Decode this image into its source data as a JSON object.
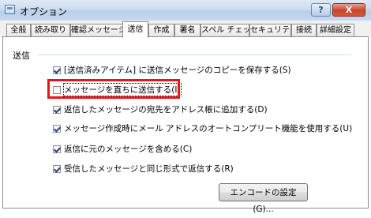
{
  "window": {
    "title": "オプション",
    "help_label": "?",
    "close_label": "X"
  },
  "tabs": [
    {
      "label": "全般",
      "active": false
    },
    {
      "label": "読み取り",
      "active": false
    },
    {
      "label": "確認メッセージ",
      "active": false
    },
    {
      "label": "送信",
      "active": true
    },
    {
      "label": "作成",
      "active": false
    },
    {
      "label": "署名",
      "active": false
    },
    {
      "label": "スペル チェック",
      "active": false
    },
    {
      "label": "セキュリティ",
      "active": false
    },
    {
      "label": "接続",
      "active": false
    },
    {
      "label": "詳細設定",
      "active": false
    }
  ],
  "send_group": {
    "label": "送信",
    "options": [
      {
        "label": "[送信済みアイテム] に送信メッセージのコピーを保存する(S)",
        "checked": true
      },
      {
        "label": "メッセージを直ちに送信する(I)",
        "checked": false
      },
      {
        "label": "返信したメッセージの宛先をアドレス帳に追加する(D)",
        "checked": true
      },
      {
        "label": "メッセージ作成時にメール アドレスのオートコンプリート機能を使用する(U)",
        "checked": true
      },
      {
        "label": "返信に元のメッセージを含める(C)",
        "checked": true
      },
      {
        "label": "受信したメッセージと同じ形式で返信する(R)",
        "checked": true
      }
    ]
  },
  "encode_button_label": "エンコードの設定(G)...",
  "highlight_color": "#e8141b"
}
